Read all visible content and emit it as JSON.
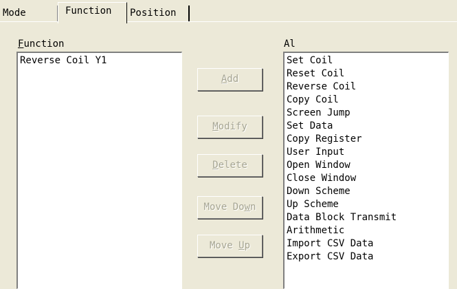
{
  "tabs": [
    {
      "label": "Mode"
    },
    {
      "label": "Function",
      "selected": true
    },
    {
      "label": "Position"
    }
  ],
  "function_panel": {
    "label_mnemonic": "F",
    "label_rest": "unction",
    "items": [
      "Reverse Coil Y1"
    ]
  },
  "all_panel": {
    "label": "Al",
    "items": [
      "Set Coil",
      "Reset Coil",
      "Reverse Coil",
      "Copy Coil",
      "Screen Jump",
      "Set Data",
      "Copy Register",
      "User Input",
      "Open Window",
      "Close Window",
      "Down Scheme",
      "Up Scheme",
      "Data Block Transmit",
      "Arithmetic",
      "Import CSV Data",
      "Export CSV Data"
    ]
  },
  "buttons": {
    "add": {
      "pre": "",
      "mnemonic": "A",
      "post": "dd",
      "enabled": false
    },
    "modify": {
      "pre": "",
      "mnemonic": "M",
      "post": "odify",
      "enabled": false
    },
    "delete": {
      "pre": "",
      "mnemonic": "D",
      "post": "elete",
      "enabled": false
    },
    "move_down": {
      "pre": "Move Do",
      "mnemonic": "w",
      "post": "n",
      "enabled": false
    },
    "move_up": {
      "pre": "Move ",
      "mnemonic": "U",
      "post": "p",
      "enabled": false
    }
  },
  "colors": {
    "dialog_bg": "#ece9d8",
    "list_bg": "#ffffff",
    "disabled_text": "#a6a592"
  }
}
